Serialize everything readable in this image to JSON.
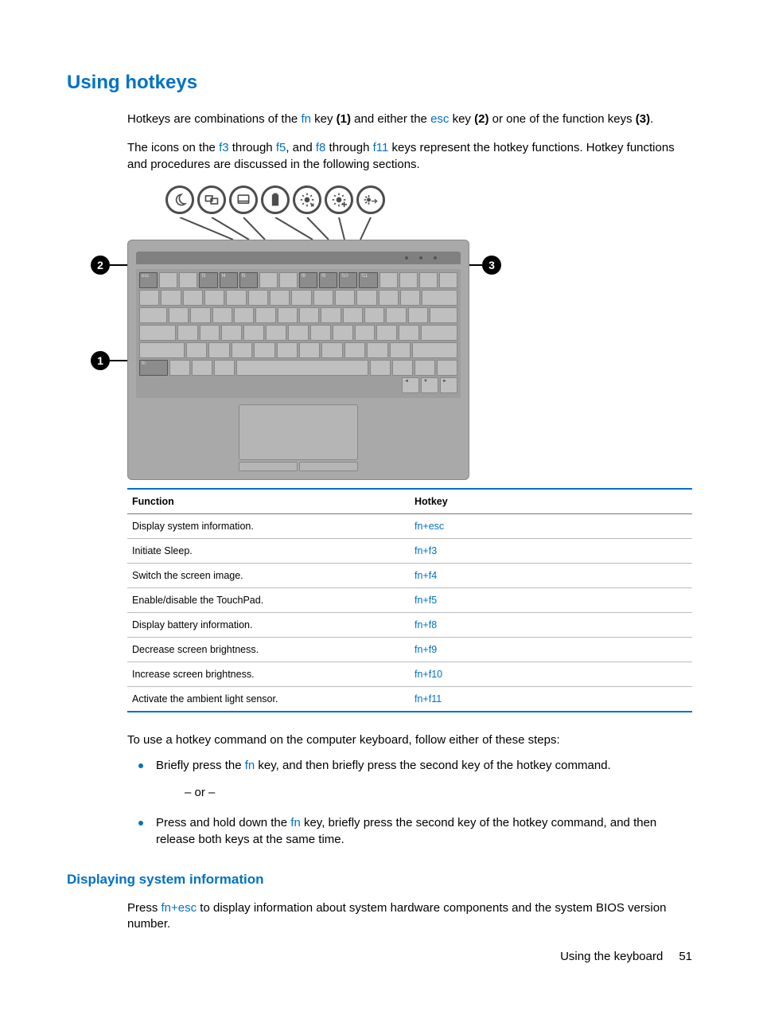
{
  "heading": "Using hotkeys",
  "intro_1": {
    "pre": "Hotkeys are combinations of the ",
    "k1": "fn",
    "t1": " key ",
    "b1": "(1)",
    "t2": " and either the ",
    "k2": "esc",
    "t3": " key ",
    "b2": "(2)",
    "t4": " or one of the function keys ",
    "b3": "(3)",
    "t5": "."
  },
  "intro_2": {
    "pre": "The icons on the ",
    "k1": "f3",
    "t1": " through ",
    "k2": "f5",
    "t2": ", and ",
    "k3": "f8",
    "t3": " through ",
    "k4": "f11",
    "t4": " keys represent the hotkey functions. Hotkey functions and procedures are discussed in the following sections."
  },
  "callouts": {
    "c1": "1",
    "c2": "2",
    "c3": "3"
  },
  "table": {
    "col_func": "Function",
    "col_hotkey": "Hotkey",
    "rows": [
      {
        "func": "Display system information.",
        "hk": "fn+esc"
      },
      {
        "func": "Initiate Sleep.",
        "hk": "fn+f3"
      },
      {
        "func": "Switch the screen image.",
        "hk": "fn+f4"
      },
      {
        "func": "Enable/disable the TouchPad.",
        "hk": "fn+f5"
      },
      {
        "func": "Display battery information.",
        "hk": "fn+f8"
      },
      {
        "func": "Decrease screen brightness.",
        "hk": "fn+f9"
      },
      {
        "func": "Increase screen brightness.",
        "hk": "fn+f10"
      },
      {
        "func": "Activate the ambient light sensor.",
        "hk": "fn+f11"
      }
    ]
  },
  "steps_intro": "To use a hotkey command on the computer keyboard, follow either of these steps:",
  "step_a": {
    "pre": "Briefly press the ",
    "k": "fn",
    "post": " key, and then briefly press the second key of the hotkey command."
  },
  "or_text": "– or –",
  "step_b": {
    "pre": "Press and hold down the ",
    "k": "fn",
    "post": " key, briefly press the second key of the hotkey command, and then release both keys at the same time."
  },
  "subheading": "Displaying system information",
  "sub_body": {
    "pre": "Press ",
    "k": "fn+esc",
    "post": " to display information about system hardware components and the system BIOS version number."
  },
  "footer": {
    "section": "Using the keyboard",
    "page": "51"
  }
}
